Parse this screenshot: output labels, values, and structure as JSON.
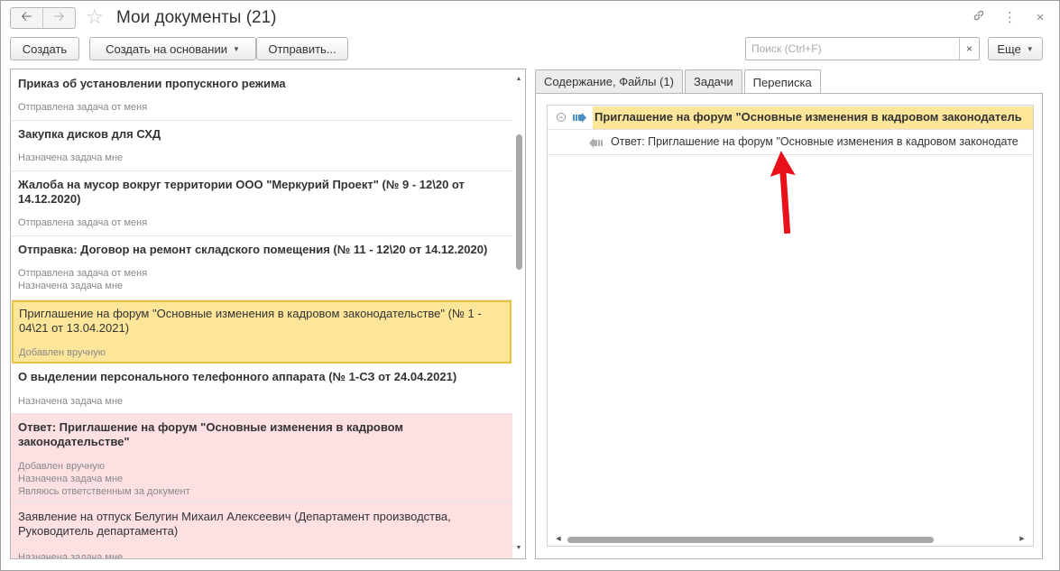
{
  "window": {
    "title": "Мои документы (21)"
  },
  "icons": {
    "back": "arrow-left-icon",
    "forward": "arrow-right-icon",
    "favorite": "star-icon",
    "link": "link-icon",
    "more": "more-vertical-icon",
    "close": "close-icon"
  },
  "toolbar": {
    "create_label": "Создать",
    "create_based_label": "Создать на основании",
    "send_label": "Отправить...",
    "search_placeholder": "Поиск (Ctrl+F)",
    "search_clear": "×",
    "more_label": "Еще"
  },
  "documents": [
    {
      "title": "Приказ об установлении пропускного режима",
      "bold": true,
      "statuses": [
        "Отправлена задача от меня"
      ]
    },
    {
      "title": "Закупка дисков для СХД",
      "bold": true,
      "statuses": [
        "Назначена задача мне"
      ]
    },
    {
      "title": "Жалоба на мусор вокруг территории ООО \"Меркурий Проект\" (№ 9 - 12\\20 от 14.12.2020)",
      "bold": true,
      "statuses": [
        "Отправлена задача от меня"
      ]
    },
    {
      "title": "Отправка: Договор на ремонт складского помещения (№ 11 - 12\\20 от 14.12.2020)",
      "bold": true,
      "statuses": [
        "Отправлена задача от меня",
        "Назначена задача мне"
      ]
    },
    {
      "title": "Приглашение на форум \"Основные изменения в кадровом законодательстве\" (№ 1 - 04\\21 от 13.04.2021)",
      "bold": false,
      "selected": true,
      "statuses": [
        "Добавлен вручную"
      ]
    },
    {
      "title": "О выделении персонального телефонного аппарата (№ 1-СЗ от 24.04.2021)",
      "bold": true,
      "statuses": [
        "Назначена задача мне"
      ]
    },
    {
      "title": "Ответ: Приглашение на форум \"Основные изменения в кадровом законодательстве\"",
      "bold": true,
      "highlight": "pink",
      "statuses": [
        "Добавлен вручную",
        "Назначена задача мне",
        "Являюсь ответственным за документ"
      ]
    },
    {
      "title": "Заявление на отпуск Белугин Михаил Алексеевич (Департамент производства, Руководитель департамента)",
      "bold": false,
      "highlight": "pink",
      "statuses": [
        "Назначена задача мне"
      ]
    }
  ],
  "tabs": [
    {
      "label": "Содержание, Файлы (1)",
      "active": false
    },
    {
      "label": "Задачи",
      "active": false
    },
    {
      "label": "Переписка",
      "active": true
    }
  ],
  "correspondence": {
    "parent": "Приглашение на форум \"Основные изменения в кадровом законодатель",
    "child": "Ответ: Приглашение на форум \"Основные изменения в кадровом законодате"
  },
  "colors": {
    "selected_bg": "#fde59a",
    "pink_bg": "#fde0e2",
    "annotation_arrow": "#e8111a",
    "outgoing_arrow": "#4a90c8"
  }
}
